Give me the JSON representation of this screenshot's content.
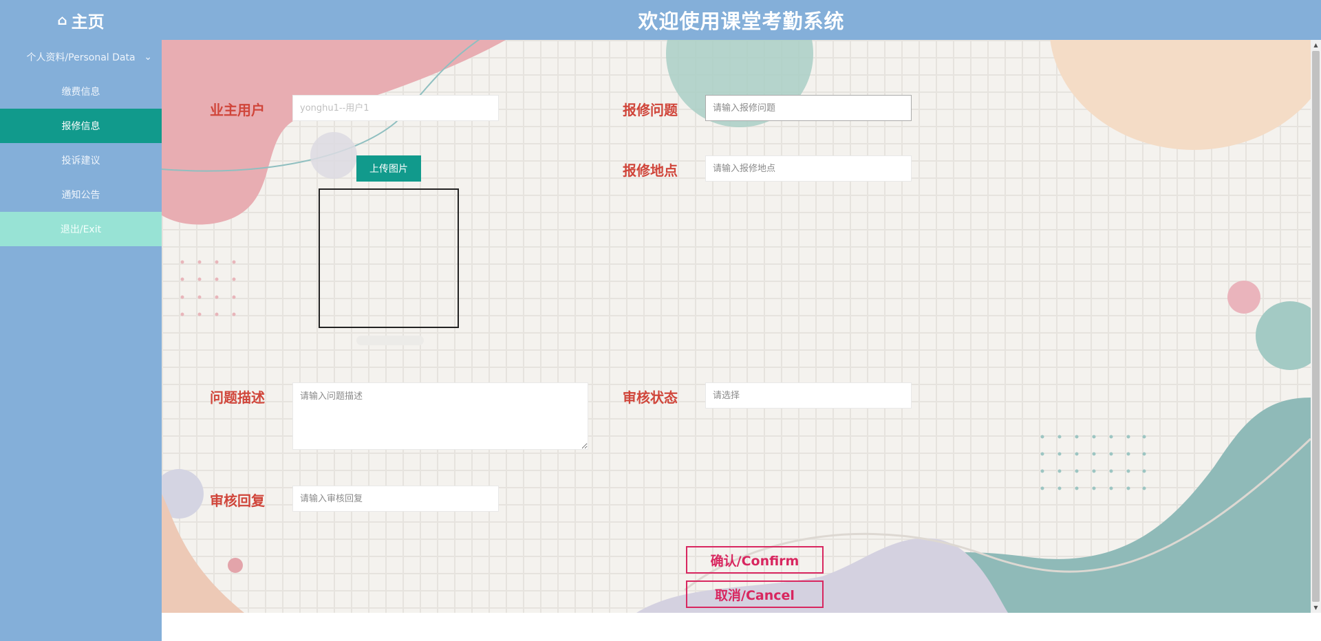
{
  "header": {
    "home_label": "主页",
    "home_icon": "home-icon",
    "system_title": "欢迎使用课堂考勤系统"
  },
  "sidebar": {
    "items": [
      {
        "label": "个人资料/Personal Data",
        "icon": "chevron-down-icon"
      },
      {
        "label": "缴费信息"
      },
      {
        "label": "报修信息",
        "active": true
      },
      {
        "label": "投诉建议"
      },
      {
        "label": "通知公告"
      },
      {
        "label": "退出/Exit"
      }
    ]
  },
  "form": {
    "owner_user": {
      "label": "业主用户",
      "placeholder": "yonghu1--用户1"
    },
    "repair_issue": {
      "label": "报修问题",
      "placeholder": "请输入报修问题"
    },
    "repair_location": {
      "label": "报修地点",
      "placeholder": "请输入报修地点"
    },
    "upload": {
      "button_label": "上传图片"
    },
    "problem_desc": {
      "label": "问题描述",
      "placeholder": "请输入问题描述"
    },
    "review_status": {
      "label": "审核状态",
      "placeholder": "请选择"
    },
    "review_reply": {
      "label": "审核回复",
      "placeholder": "请输入审核回复"
    }
  },
  "actions": {
    "confirm_label": "确认/Confirm",
    "cancel_label": "取消/Cancel"
  },
  "colors": {
    "header_bg": "#84afd9",
    "active_menu": "#119a8c",
    "exit_menu": "#98e3d5",
    "label_red": "#d0453a",
    "button_pink": "#d8265f"
  }
}
